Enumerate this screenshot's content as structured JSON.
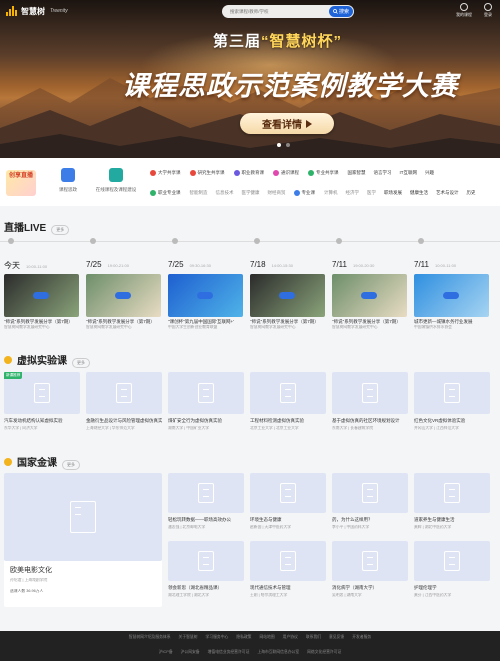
{
  "header": {
    "logo_text": "智慧树",
    "logo_sub": "Treenity",
    "search_placeholder": "搜索课程/教师/学校",
    "search_button": "搜索",
    "icons": [
      {
        "name": "user-icon",
        "label": "我的课程"
      },
      {
        "name": "login-icon",
        "label": "登录"
      }
    ]
  },
  "banner": {
    "title_prefix": "第三届",
    "title_highlight": "“智慧树杯”",
    "title_main": "课程思政示范案例教学大赛",
    "cta": "查看详情",
    "slide_count": 2,
    "active_slide": 1
  },
  "categories": {
    "hero_text": "创享直播",
    "big": [
      {
        "label": "课程思政",
        "color": "#3d7de8"
      },
      {
        "label": "在线课程及课程建设",
        "color": "#22a9a0"
      }
    ],
    "row1": [
      {
        "label": "大学共享课",
        "color": "#e8483c"
      },
      {
        "label": "研究生共享课",
        "color": "#e8483c"
      },
      {
        "label": "职业教育课",
        "color": "#6a5ae0"
      },
      {
        "label": "通识课程",
        "color": "#e04ab0"
      },
      {
        "label": "专业共享课",
        "color": "#2fb36b"
      }
    ],
    "row1_subs": [
      "国家智慧",
      "语言学习",
      "IT互联网",
      "兴趣"
    ],
    "row2_lead": {
      "label": "职业专业课",
      "color": "#2fb36b"
    },
    "row2_subs": [
      "智能制造",
      "信息技术",
      "医学健康",
      "财经商贸"
    ],
    "row2_lead2": {
      "label": "专业课",
      "color": "#3d7de8"
    },
    "row2_subs2": [
      "计算机",
      "经济学",
      "医学",
      "人文社科",
      "职场发展",
      "健康生活",
      "艺术与设计",
      "历史"
    ]
  },
  "live": {
    "title": "直播LIVE",
    "more": "更多",
    "items": [
      {
        "day": "今天",
        "time": "10:00-11:00",
        "title": "\"师说\"系列教学发展分享（第7期）",
        "sub": "智慧树网教学发展研究中心",
        "color1": "#2b2b2b",
        "color2": "#8aa47a"
      },
      {
        "day": "7/25",
        "time": "19:00-21:00",
        "title": "\"师说\"系列教学发展分享（第7期）",
        "sub": "智慧树网教学发展研究中心",
        "color1": "#6d8e6a",
        "color2": "#e8dcc3"
      },
      {
        "day": "7/25",
        "time": "09:30-16:30",
        "title": "\"课创杯\"第九届中国国际'互联网+'",
        "sub": "中国大学生创新创业教育联盟",
        "color1": "#1e5fd0",
        "color2": "#4fb3e8"
      },
      {
        "day": "7/18",
        "time": "14:00-15:30",
        "title": "\"师说\"系列教学发展分享（第7期）",
        "sub": "智慧树网教学发展研究中心",
        "color1": "#2b2b2b",
        "color2": "#8aa47a"
      },
      {
        "day": "7/11",
        "time": "19:00-20:30",
        "title": "\"师说\"系列教学发展分享（第7期）",
        "sub": "智慧树网教学发展研究中心",
        "color1": "#6d8e6a",
        "color2": "#e8dcc3"
      },
      {
        "day": "7/11",
        "time": "10:00-11:00",
        "title": "城市更新—城镇水务行业发展",
        "sub": "中国城镇供水排水协会",
        "color1": "#2f8fe0",
        "color2": "#a6d4f2"
      }
    ]
  },
  "virtual_lab": {
    "title": "虚拟实验课",
    "more": "更多",
    "badge": "新课推荐",
    "items": [
      {
        "title": "汽车发动机结构认知虚拟实验",
        "sub": "东华大学 | 同济大学"
      },
      {
        "title": "金融衍生品设计与风险管理虚拟仿真实验",
        "sub": "上海财经大学 | 华东师范大学"
      },
      {
        "title": "煤矿安全行为虚拟仿真实验",
        "sub": "湖南大学 | 中国矿业大学"
      },
      {
        "title": "工程材料检测虚拟仿真实验",
        "sub": "北京工业大学 | 北京工业大学"
      },
      {
        "title": "基于虚拟仿真的社区环境规划设计",
        "sub": "东南大学 | 长春建筑学院"
      },
      {
        "title": "红色文化VR虚拟体验实验",
        "sub": "井冈山大学 | 江西师范大学"
      }
    ]
  },
  "golden": {
    "title": "国家金课",
    "more": "更多",
    "featured": {
      "title": "欧美电影文化",
      "sub": "孙绍谊 | 上海戏剧学院",
      "stats": "选课人数 36.96万人"
    },
    "items": [
      {
        "title": "轻松玩转数据——职场高效办公",
        "sub": "潘志强 | 北京邮电大学"
      },
      {
        "title": "环境生态与健康",
        "sub": "赵新国 | 天津中医药大学"
      },
      {
        "title": "药，为什么这样用？",
        "sub": "李小平 | 中国药科大学"
      },
      {
        "title": "道家养生与健康生活",
        "sub": "黄辉 | 湖北中医药大学"
      },
      {
        "title": "领会新思（湖北省精品课）",
        "sub": "湖北理工学院 | 湖北大学"
      },
      {
        "title": "现代通信技术与管理",
        "sub": "王刚 | 哈尔滨理工大学"
      },
      {
        "title": "消化病学（湖南大学）",
        "sub": "吴明忠 | 湖南大学"
      },
      {
        "title": "护理伦理学",
        "sub": "黄芬 | 江西中医药大学"
      }
    ]
  },
  "footer": {
    "links1": [
      "智慧树网介绍及服务体系",
      "关于智慧树",
      "学习服务中心",
      "隐私政策",
      "网站地图",
      "用户协议",
      "联系我们",
      "意见反馈",
      "开发者服务"
    ],
    "links2": [
      "沪ICP备",
      "沪公网安备",
      "增值电信业务经营许可证",
      "上海市互联网信息办公室",
      "网络文化经营许可证"
    ]
  }
}
